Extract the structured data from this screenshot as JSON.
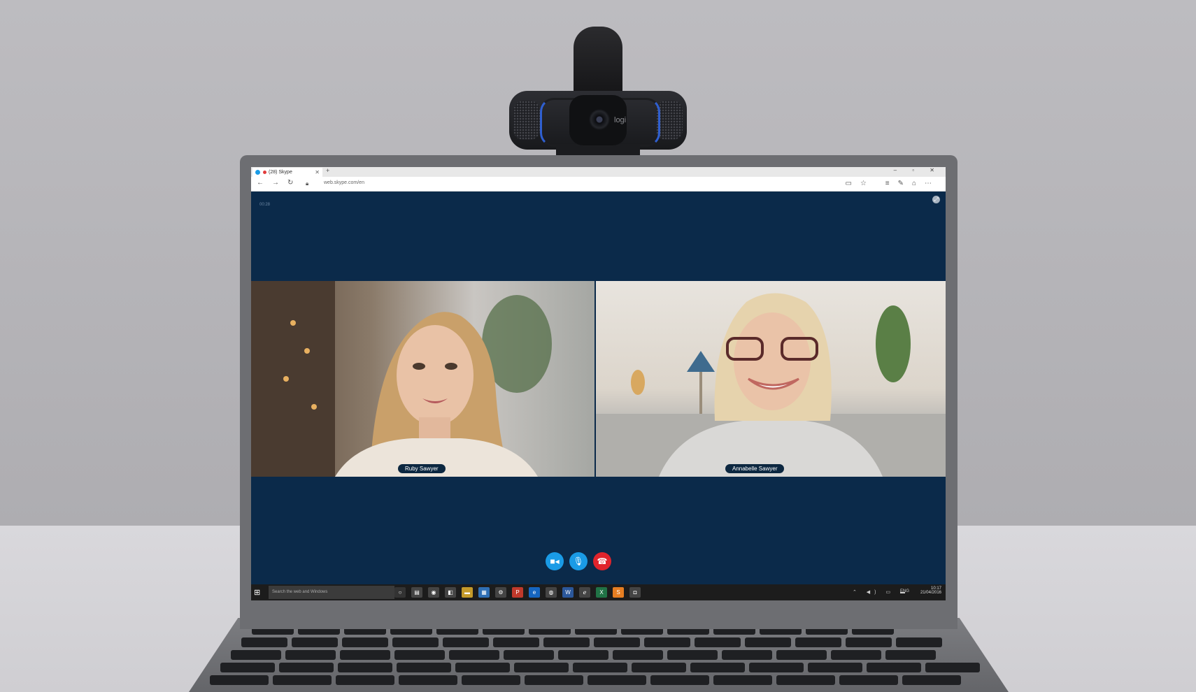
{
  "browser": {
    "tab_title": "(28) Skype",
    "new_tab": "+",
    "window_controls": "– ▫ ✕",
    "url": "web.skype.com/en",
    "nav_icons": [
      "arrow-left-icon",
      "arrow-right-icon",
      "refresh-icon"
    ],
    "tool_icons": [
      "reading-view-icon",
      "star-icon",
      "hub-icon",
      "pen-icon",
      "share-icon",
      "more-icon"
    ]
  },
  "call": {
    "timer": "00:28",
    "participants": [
      {
        "name": "Ruby Sawyer"
      },
      {
        "name": "Annabelle Sawyer"
      }
    ],
    "controls": [
      {
        "icon": "video-camera-icon",
        "color": "#1a9be6"
      },
      {
        "icon": "microphone-icon",
        "color": "#1a9be6"
      },
      {
        "icon": "hang-up-icon",
        "color": "#e0242c"
      }
    ]
  },
  "taskbar": {
    "search_placeholder": "Search the web and Windows",
    "tray_language": "ENG",
    "time": "10:17",
    "date": "21/04/2016"
  },
  "webcam": {
    "brand": "logi"
  }
}
